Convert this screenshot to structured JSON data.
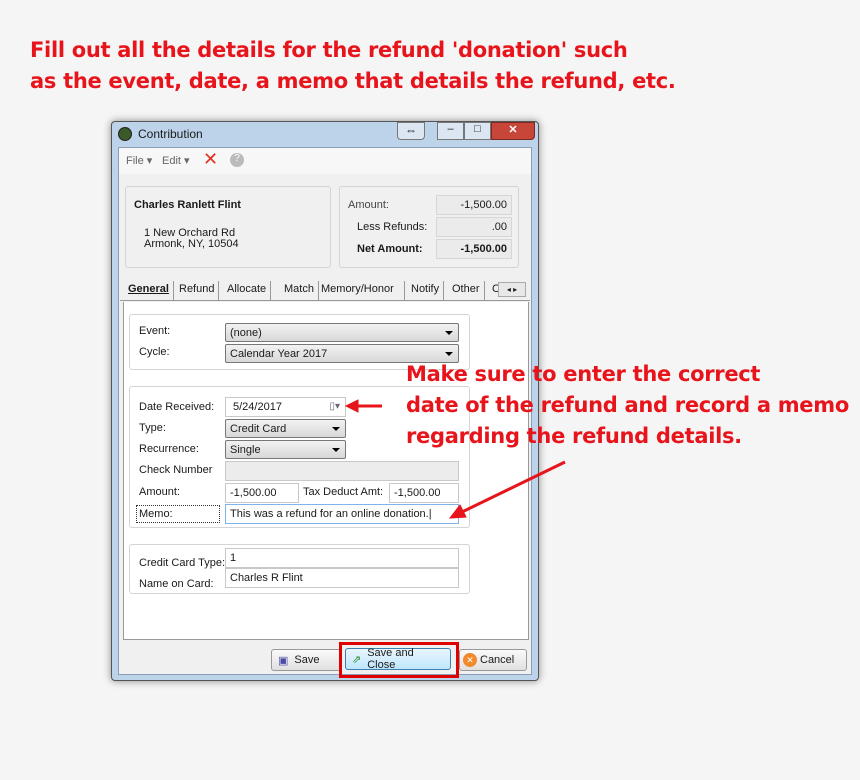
{
  "annotations": {
    "top_line1": "Fill out all the details for the refund 'donation' such",
    "top_line2": "as the event, date, a memo that details the refund, etc.",
    "side_line1": "Make sure to enter the correct",
    "side_line2": "date of the refund and record a memo",
    "side_line3": "regarding the refund details.",
    "color": "#e8141c"
  },
  "window": {
    "title": "Contribution"
  },
  "toolbar": {
    "file": "File",
    "edit": "Edit"
  },
  "donor": {
    "name": "Charles Ranlett Flint",
    "address1": "1 New Orchard Rd",
    "address2": "Armonk, NY, 10504"
  },
  "totals": {
    "amount_label": "Amount:",
    "amount": "-1,500.00",
    "refunds_label": "Less Refunds:",
    "refunds": ".00",
    "net_label": "Net Amount:",
    "net": "-1,500.00"
  },
  "tabs": [
    "General",
    "Refund",
    "Allocate",
    "Match",
    "Memory/Honor",
    "Notify",
    "Other",
    "C"
  ],
  "form": {
    "event_label": "Event:",
    "event": "(none)",
    "cycle_label": "Cycle:",
    "cycle": "Calendar Year 2017",
    "date_label": "Date Received:",
    "date": "5/24/2017",
    "type_label": "Type:",
    "type": "Credit Card",
    "recurrence_label": "Recurrence:",
    "recurrence": "Single",
    "check_label": "Check Number",
    "check": "",
    "amount_label": "Amount:",
    "amount": "-1,500.00",
    "tax_label": "Tax Deduct Amt:",
    "tax": "-1,500.00",
    "memo_label": "Memo:",
    "memo": "This was a refund for an online donation.",
    "cc_type_label": "Credit Card Type:",
    "cc_type": "1",
    "name_label": "Name on Card:",
    "name": "Charles R Flint"
  },
  "buttons": {
    "save": "Save",
    "save_close": "Save and Close",
    "cancel": "Cancel"
  }
}
